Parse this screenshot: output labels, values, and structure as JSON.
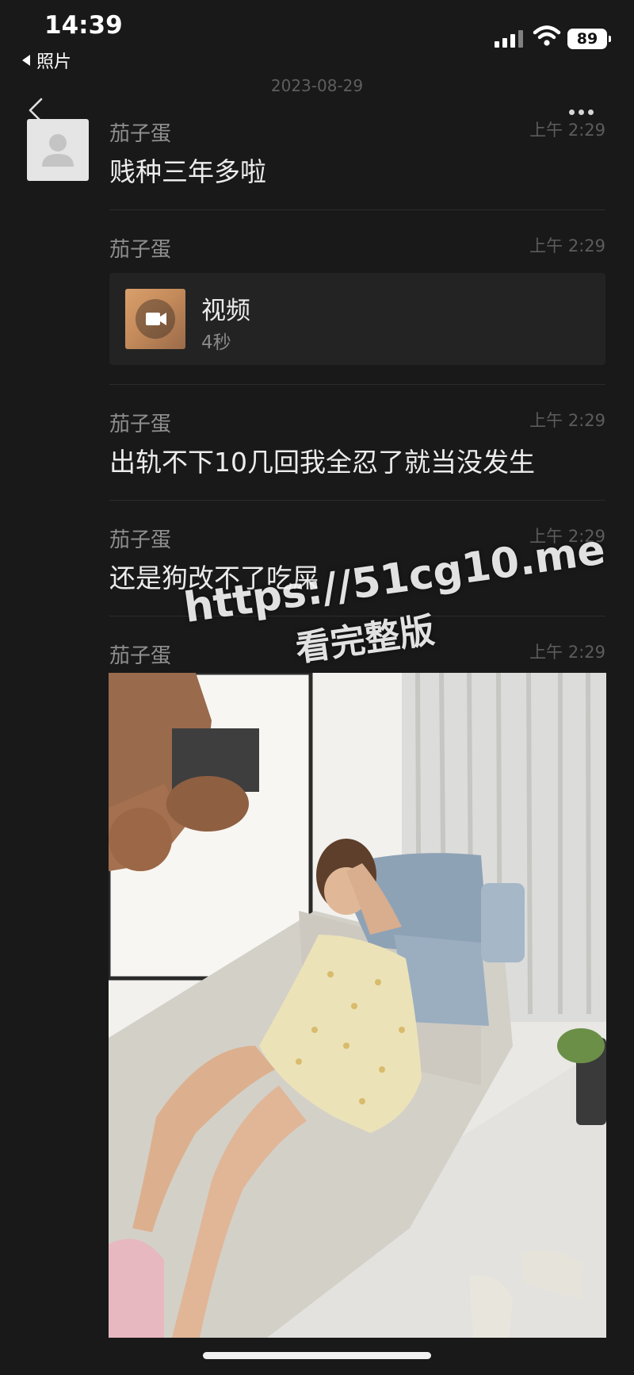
{
  "status_bar": {
    "time": "14:39",
    "back_app": "照片",
    "battery": "89"
  },
  "chat": {
    "date": "2023-08-29",
    "messages": [
      {
        "sender": "茄子蛋",
        "time": "上午 2:29",
        "text": "贱种三年多啦"
      },
      {
        "sender": "茄子蛋",
        "time": "上午 2:29",
        "video": {
          "title": "视频",
          "duration": "4秒"
        }
      },
      {
        "sender": "茄子蛋",
        "time": "上午 2:29",
        "text": "出轨不下10几回我全忍了就当没发生"
      },
      {
        "sender": "茄子蛋",
        "time": "上午 2:29",
        "text": "还是狗改不了吃屎"
      },
      {
        "sender": "茄子蛋",
        "time": "上午 2:29",
        "image": "photo"
      }
    ]
  },
  "watermark": {
    "line1": "https://51cg10.me",
    "line2": "看完整版"
  },
  "icons": [
    "back-arrow-icon",
    "more-icon",
    "signal-icon",
    "wifi-icon",
    "battery-icon",
    "video-camera-icon",
    "avatar-placeholder-icon"
  ]
}
